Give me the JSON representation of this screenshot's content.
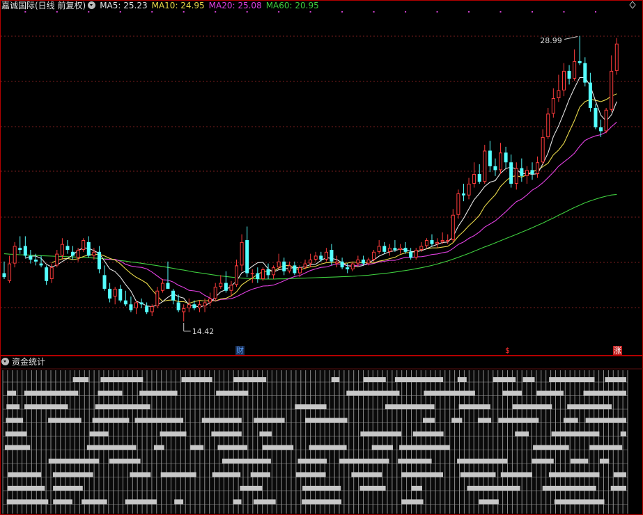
{
  "header": {
    "title": "嘉诚国际(日线 前复权)",
    "ma": [
      {
        "label": "MA5: 25.23",
        "color": "#e6e6e6"
      },
      {
        "label": "MA10: 24.95",
        "color": "#e8d84a"
      },
      {
        "label": "MA20: 25.08",
        "color": "#e040e0"
      },
      {
        "label": "MA60: 20.95",
        "color": "#3fcf3f"
      }
    ]
  },
  "annotations": {
    "high_price": "28.99",
    "low_price": "14.42"
  },
  "event_markers": [
    {
      "label": "财",
      "color": "#5aa0ff",
      "bg": "#1a2f55"
    },
    {
      "label": "$",
      "color": "#ff3030",
      "bg": "#000000"
    },
    {
      "label": "涨",
      "color": "#ffffff",
      "bg": "#c02020"
    }
  ],
  "bottom_panel": {
    "title": "资金统计"
  },
  "colors": {
    "up": "#ff3c3c",
    "down": "#54ffff",
    "grid": "#7a1e1e",
    "border": "#b40000",
    "ma5": "#e6e6e6",
    "ma10": "#e8d84a",
    "ma20": "#e040e0",
    "ma60": "#3fcf3f"
  },
  "icons": [
    "dropdown-icon",
    "diamond-icon"
  ],
  "chart_data": {
    "type": "candlestick",
    "title": "嘉诚国际(日线 前复权)",
    "ylim": [
      13.2,
      30.3
    ],
    "series_ohlc_note": "open, high, low, close per trading day, read off the price axis",
    "ohlc": [
      [
        16.9,
        17.5,
        16.6,
        16.7
      ],
      [
        16.5,
        17.8,
        16.4,
        17.4
      ],
      [
        17.4,
        18.5,
        17.2,
        18.3
      ],
      [
        18.2,
        18.8,
        17.9,
        18.1
      ],
      [
        18.3,
        18.8,
        17.7,
        17.8
      ],
      [
        17.8,
        18.1,
        17.4,
        17.6
      ],
      [
        17.6,
        17.9,
        17.3,
        17.5
      ],
      [
        17.4,
        17.8,
        17.2,
        17.3
      ],
      [
        17.2,
        17.3,
        16.3,
        16.5
      ],
      [
        16.6,
        17.4,
        16.4,
        17.2
      ],
      [
        17.3,
        18.1,
        17.2,
        17.9
      ],
      [
        17.8,
        18.7,
        17.6,
        18.4
      ],
      [
        18.3,
        18.6,
        17.9,
        18.1
      ],
      [
        18.0,
        18.3,
        17.6,
        17.8
      ],
      [
        17.7,
        18.2,
        17.5,
        18.1
      ],
      [
        18.1,
        18.7,
        18.0,
        18.6
      ],
      [
        18.5,
        18.8,
        17.7,
        17.8
      ],
      [
        17.8,
        18.2,
        17.6,
        18.0
      ],
      [
        18.0,
        18.3,
        16.9,
        17.1
      ],
      [
        16.8,
        17.3,
        16.0,
        16.1
      ],
      [
        16.1,
        16.4,
        15.4,
        15.6
      ],
      [
        15.7,
        16.2,
        15.3,
        16.1
      ],
      [
        16.1,
        16.3,
        15.4,
        15.5
      ],
      [
        15.5,
        16.0,
        15.2,
        15.3
      ],
      [
        15.3,
        15.7,
        14.9,
        15.0
      ],
      [
        15.1,
        15.5,
        14.8,
        15.4
      ],
      [
        15.4,
        15.6,
        15.1,
        15.3
      ],
      [
        15.2,
        15.4,
        14.8,
        14.9
      ],
      [
        14.9,
        15.3,
        14.7,
        15.2
      ],
      [
        15.2,
        16.2,
        15.1,
        16.0
      ],
      [
        16.0,
        16.6,
        15.9,
        16.4
      ],
      [
        16.4,
        17.5,
        16.2,
        16.1
      ],
      [
        16.0,
        16.1,
        15.3,
        15.5
      ],
      [
        15.4,
        15.8,
        14.9,
        15.0
      ],
      [
        14.9,
        15.3,
        14.42,
        15.1
      ],
      [
        15.1,
        15.6,
        14.9,
        15.3
      ],
      [
        15.3,
        15.5,
        15.0,
        15.1
      ],
      [
        15.1,
        15.5,
        14.9,
        15.3
      ],
      [
        15.2,
        15.6,
        14.9,
        15.4
      ],
      [
        15.4,
        15.9,
        15.2,
        15.6
      ],
      [
        15.6,
        16.4,
        15.5,
        16.2
      ],
      [
        16.2,
        16.8,
        16.1,
        16.4
      ],
      [
        16.4,
        17.0,
        15.9,
        16.0
      ],
      [
        16.0,
        16.5,
        15.7,
        16.3
      ],
      [
        16.3,
        17.6,
        16.2,
        17.3
      ],
      [
        17.3,
        18.9,
        17.0,
        18.5
      ],
      [
        18.6,
        19.3,
        16.7,
        16.9
      ],
      [
        16.9,
        17.1,
        16.4,
        16.9
      ],
      [
        16.9,
        17.2,
        16.4,
        16.6
      ],
      [
        16.6,
        17.2,
        16.5,
        17.1
      ],
      [
        17.1,
        17.4,
        16.6,
        16.8
      ],
      [
        16.8,
        17.3,
        16.6,
        17.2
      ],
      [
        17.2,
        17.9,
        17.1,
        17.5
      ],
      [
        17.5,
        17.7,
        16.8,
        17.0
      ],
      [
        17.0,
        17.5,
        16.9,
        17.3
      ],
      [
        17.3,
        17.5,
        16.8,
        16.9
      ],
      [
        16.9,
        17.3,
        16.7,
        17.2
      ],
      [
        17.2,
        17.6,
        17.1,
        17.4
      ],
      [
        17.4,
        17.9,
        17.2,
        17.6
      ],
      [
        17.6,
        18.0,
        17.5,
        17.8
      ],
      [
        17.8,
        18.0,
        17.5,
        17.6
      ],
      [
        17.6,
        18.2,
        17.5,
        18.0
      ],
      [
        18.1,
        18.4,
        17.3,
        17.5
      ],
      [
        17.4,
        17.8,
        17.2,
        17.5
      ],
      [
        17.5,
        17.7,
        17.1,
        17.2
      ],
      [
        17.2,
        17.4,
        16.9,
        17.1
      ],
      [
        17.1,
        17.5,
        17.0,
        17.4
      ],
      [
        17.4,
        17.8,
        17.2,
        17.6
      ],
      [
        17.6,
        17.8,
        17.3,
        17.4
      ],
      [
        17.4,
        17.7,
        17.3,
        17.6
      ],
      [
        17.6,
        18.1,
        17.5,
        18.0
      ],
      [
        18.0,
        18.6,
        17.9,
        18.3
      ],
      [
        18.3,
        18.5,
        17.9,
        18.0
      ],
      [
        18.0,
        18.4,
        17.8,
        18.2
      ],
      [
        18.2,
        18.6,
        18.0,
        18.1
      ],
      [
        18.1,
        18.4,
        17.9,
        18.2
      ],
      [
        18.2,
        18.5,
        17.9,
        18.0
      ],
      [
        18.0,
        18.2,
        17.6,
        17.7
      ],
      [
        17.7,
        18.2,
        17.6,
        18.1
      ],
      [
        18.1,
        18.5,
        18.0,
        18.3
      ],
      [
        18.3,
        18.7,
        18.2,
        18.6
      ],
      [
        18.6,
        18.9,
        18.3,
        18.4
      ],
      [
        18.4,
        18.7,
        18.2,
        18.5
      ],
      [
        18.5,
        19.0,
        18.4,
        18.6
      ],
      [
        18.6,
        18.9,
        18.4,
        18.6
      ],
      [
        18.6,
        20.2,
        18.5,
        19.9
      ],
      [
        19.9,
        21.2,
        19.7,
        21.0
      ],
      [
        21.0,
        21.5,
        20.6,
        20.9
      ],
      [
        20.9,
        21.8,
        20.7,
        21.5
      ],
      [
        21.5,
        22.6,
        21.3,
        22.0
      ],
      [
        22.0,
        22.5,
        21.5,
        21.6
      ],
      [
        21.6,
        23.5,
        21.5,
        23.2
      ],
      [
        23.2,
        23.7,
        22.1,
        22.4
      ],
      [
        22.4,
        22.8,
        21.9,
        22.2
      ],
      [
        22.2,
        23.6,
        22.0,
        23.1
      ],
      [
        23.1,
        23.4,
        22.3,
        22.6
      ],
      [
        22.6,
        23.0,
        21.3,
        21.5
      ],
      [
        21.5,
        22.6,
        21.2,
        22.3
      ],
      [
        22.3,
        22.8,
        21.6,
        21.9
      ],
      [
        21.9,
        22.4,
        21.5,
        22.2
      ],
      [
        22.2,
        22.6,
        21.7,
        22.0
      ],
      [
        22.0,
        22.9,
        21.8,
        22.6
      ],
      [
        22.6,
        24.3,
        22.5,
        23.9
      ],
      [
        23.9,
        25.4,
        23.8,
        25.1
      ],
      [
        25.1,
        26.4,
        24.9,
        25.9
      ],
      [
        25.9,
        27.1,
        25.7,
        26.3
      ],
      [
        26.3,
        27.7,
        26.0,
        27.3
      ],
      [
        27.3,
        27.6,
        26.6,
        26.9
      ],
      [
        26.9,
        28.4,
        26.8,
        27.8
      ],
      [
        27.8,
        29.1,
        27.6,
        27.7
      ],
      [
        27.7,
        28.0,
        26.5,
        26.7
      ],
      [
        26.7,
        27.2,
        25.2,
        25.4
      ],
      [
        25.4,
        25.6,
        24.3,
        24.4
      ],
      [
        24.4,
        24.8,
        23.9,
        24.2
      ],
      [
        24.2,
        25.4,
        24.1,
        25.3
      ],
      [
        25.3,
        28.1,
        25.2,
        27.3
      ],
      [
        27.3,
        28.99,
        27.1,
        28.7
      ]
    ],
    "ma5": [
      null,
      null,
      null,
      null,
      17.66,
      17.78,
      17.78,
      17.66,
      17.36,
      17.22,
      17.32,
      17.5,
      17.66,
      17.84,
      18.07,
      18.2,
      18.18,
      18.06,
      17.92,
      17.52,
      17.12,
      16.98,
      16.7,
      16.32,
      15.98,
      15.46,
      15.36,
      15.22,
      15.18,
      15.26,
      15.44,
      15.66,
      15.84,
      15.7,
      15.62,
      15.26,
      15.22,
      15.16,
      15.24,
      15.38,
      15.68,
      15.94,
      16.06,
      16.24,
      16.5,
      16.92,
      17.04,
      17.26,
      17.44,
      17.46,
      17.12,
      16.96,
      17.08,
      17.12,
      17.16,
      17.18,
      17.18,
      17.24,
      17.34,
      17.36,
      17.56,
      17.7,
      17.66,
      17.6,
      17.44,
      17.28,
      17.26,
      17.24,
      17.3,
      17.44,
      17.58,
      17.78,
      17.9,
      18.0,
      18.06,
      18.14,
      18.12,
      18.02,
      18.0,
      18.06,
      18.16,
      18.28,
      18.38,
      18.48,
      18.5,
      18.78,
      19.32,
      19.72,
      20.2,
      20.68,
      21.0,
      21.36,
      21.58,
      21.66,
      22.04,
      22.28,
      22.36,
      22.24,
      22.02,
      22.04,
      21.98,
      22.02,
      22.52,
      23.08,
      23.92,
      24.48,
      25.14,
      25.84,
      26.42,
      26.96,
      26.96,
      26.52,
      25.74,
      25.02,
      24.72,
      25.04,
      25.72
    ],
    "ma10": [
      null,
      null,
      null,
      null,
      null,
      null,
      null,
      null,
      null,
      17.44,
      17.55,
      17.64,
      17.66,
      17.6,
      17.64,
      17.76,
      17.84,
      17.86,
      17.88,
      17.79,
      17.66,
      17.58,
      17.38,
      17.12,
      16.89,
      16.69,
      16.55,
      16.38,
      16.05,
      15.73,
      15.45,
      15.51,
      15.53,
      15.44,
      15.44,
      15.35,
      15.44,
      15.5,
      15.47,
      15.5,
      15.47,
      15.58,
      15.61,
      15.74,
      15.94,
      16.3,
      16.49,
      16.66,
      16.84,
      16.98,
      17.02,
      17.0,
      17.17,
      17.28,
      17.31,
      17.15,
      17.07,
      17.16,
      17.23,
      17.26,
      17.37,
      17.44,
      17.45,
      17.47,
      17.4,
      17.42,
      17.48,
      17.45,
      17.45,
      17.44,
      17.43,
      17.52,
      17.57,
      17.65,
      17.72,
      17.86,
      17.95,
      17.96,
      18.03,
      18.06,
      18.15,
      18.2,
      18.2,
      18.24,
      18.28,
      18.47,
      18.8,
      19.05,
      19.34,
      19.59,
      19.88,
      20.34,
      20.65,
      20.93,
      21.36,
      21.64,
      21.86,
      21.91,
      21.84,
      21.96,
      22.13,
      22.19,
      22.38,
      22.55,
      22.98,
      23.23,
      23.58,
      24.18,
      24.75,
      25.44,
      25.72,
      25.83,
      25.79,
      25.72,
      25.82,
      26.0,
      26.12
    ],
    "ma20": [
      null,
      null,
      null,
      null,
      null,
      null,
      null,
      null,
      null,
      null,
      null,
      null,
      null,
      null,
      null,
      null,
      null,
      null,
      null,
      17.62,
      17.61,
      17.61,
      17.52,
      17.36,
      17.27,
      17.22,
      17.2,
      17.12,
      16.96,
      16.76,
      16.56,
      16.55,
      16.45,
      16.28,
      16.17,
      16.02,
      15.99,
      15.94,
      15.76,
      15.62,
      15.46,
      15.55,
      15.57,
      15.59,
      15.69,
      15.83,
      15.97,
      16.08,
      16.16,
      16.24,
      16.25,
      16.29,
      16.39,
      16.51,
      16.63,
      16.73,
      16.78,
      16.91,
      17.04,
      17.12,
      17.2,
      17.22,
      17.31,
      17.38,
      17.36,
      17.29,
      17.28,
      17.31,
      17.34,
      17.35,
      17.4,
      17.48,
      17.51,
      17.56,
      17.56,
      17.64,
      17.72,
      17.71,
      17.74,
      17.75,
      17.79,
      17.86,
      17.89,
      17.95,
      18.0,
      18.17,
      18.38,
      18.51,
      18.69,
      18.83,
      19.02,
      19.27,
      19.43,
      19.59,
      19.82,
      20.06,
      20.33,
      20.58,
      20.71,
      20.92,
      21.17,
      21.33,
      21.55,
      21.81,
      22.09,
      22.4,
      22.62,
      22.83,
      23.07,
      23.43,
      23.73,
      23.86,
      23.96,
      24.02,
      24.15,
      24.43,
      24.67
    ],
    "ma60": [
      17.9,
      17.88,
      17.87,
      17.85,
      17.84,
      17.83,
      17.82,
      17.8,
      17.79,
      17.78,
      17.77,
      17.76,
      17.75,
      17.74,
      17.72,
      17.71,
      17.7,
      17.68,
      17.66,
      17.64,
      17.61,
      17.58,
      17.55,
      17.52,
      17.48,
      17.45,
      17.41,
      17.37,
      17.33,
      17.29,
      17.24,
      17.2,
      17.15,
      17.1,
      17.06,
      17.01,
      16.96,
      16.92,
      16.88,
      16.84,
      16.8,
      16.76,
      16.73,
      16.7,
      16.67,
      16.65,
      16.63,
      16.62,
      16.61,
      16.6,
      16.6,
      16.6,
      16.61,
      16.61,
      16.62,
      16.63,
      16.64,
      16.65,
      16.66,
      16.67,
      16.68,
      16.69,
      16.7,
      16.71,
      16.72,
      16.73,
      16.74,
      16.76,
      16.78,
      16.8,
      16.83,
      16.86,
      16.89,
      16.92,
      16.96,
      17.0,
      17.04,
      17.08,
      17.13,
      17.18,
      17.24,
      17.3,
      17.37,
      17.45,
      17.53,
      17.62,
      17.72,
      17.82,
      17.92,
      18.03,
      18.14,
      18.25,
      18.35,
      18.46,
      18.57,
      18.68,
      18.79,
      18.9,
      19.01,
      19.12,
      19.24,
      19.36,
      19.48,
      19.61,
      19.74,
      19.88,
      20.01,
      20.15,
      20.28,
      20.4,
      20.52,
      20.62,
      20.71,
      20.79,
      20.86,
      20.92,
      20.95
    ]
  }
}
